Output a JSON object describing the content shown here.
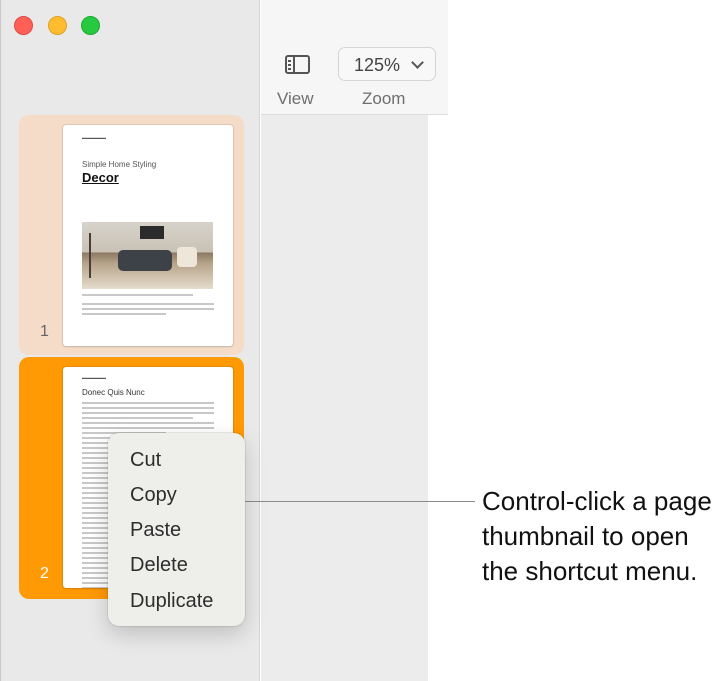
{
  "toolbar": {
    "view_label": "View",
    "zoom_label": "Zoom",
    "zoom_value": "125%"
  },
  "thumbnails": [
    {
      "page_number": "1",
      "sub_heading": "Simple Home Styling",
      "heading": "Decor"
    },
    {
      "page_number": "2",
      "heading": "Donec Quis Nunc"
    }
  ],
  "context_menu": {
    "items": [
      "Cut",
      "Copy",
      "Paste",
      "Delete",
      "Duplicate"
    ]
  },
  "callout": {
    "text": "Control-click a page thumbnail to open the shortcut menu."
  },
  "colors": {
    "page_one_background": "#f4dcc8",
    "page_two_selected_background": "#ff9a05",
    "close": "#ff5f57",
    "minimize": "#febc2e",
    "maximize": "#28c840"
  },
  "icons": {
    "view": "sidebar-icon",
    "zoom": "chevron-down-icon"
  }
}
